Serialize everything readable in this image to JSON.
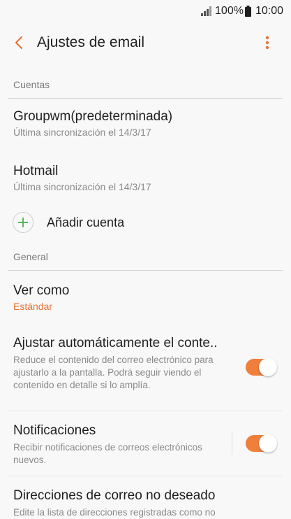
{
  "status_bar": {
    "battery_percent": "100%",
    "time": "10:00"
  },
  "header": {
    "title": "Ajustes de email"
  },
  "sections": {
    "accounts": {
      "label": "Cuentas",
      "items": [
        {
          "title": "Groupwm(predeterminada)",
          "subtitle": "Última sincronización el 14/3/17"
        },
        {
          "title": "Hotmail",
          "subtitle": "Última sincronización el 14/3/17"
        }
      ],
      "add_label": "Añadir cuenta"
    },
    "general": {
      "label": "General",
      "view_as": {
        "title": "Ver como",
        "value": "Estándar"
      },
      "auto_fit": {
        "title": "Ajustar automáticamente el conte..",
        "description": "Reduce el contenido del correo electrónico para ajustarlo a la pantalla. Podrá seguir viendo el contenido en detalle si lo amplía.",
        "enabled": true
      },
      "notifications": {
        "title": "Notificaciones",
        "description": "Recibir notificaciones de correos electrónicos nuevos.",
        "enabled": true
      },
      "spam": {
        "title": "Direcciones de correo no deseado",
        "description": "Edite la lista de direcciones registradas como no deseadas."
      }
    }
  },
  "colors": {
    "accent": "#f07f3c",
    "accent_text": "#e67538",
    "add_icon": "#4caf50"
  }
}
